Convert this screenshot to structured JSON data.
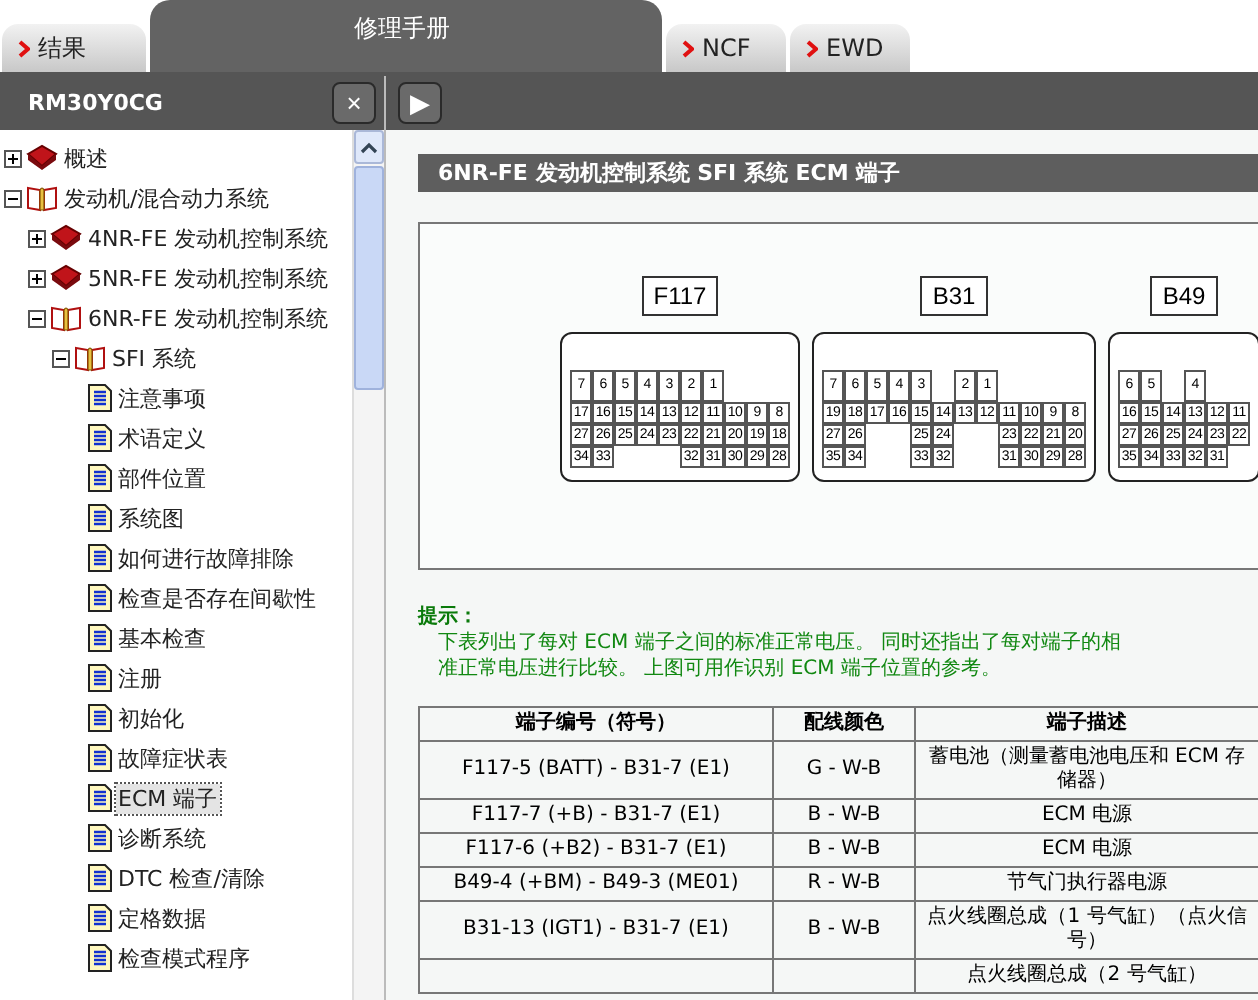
{
  "tabs": [
    {
      "label": "结果",
      "arrow": true,
      "selected": false
    },
    {
      "label": "修理手册",
      "arrow": false,
      "selected": true
    },
    {
      "label": "NCF",
      "arrow": true,
      "selected": false
    },
    {
      "label": "EWD",
      "arrow": true,
      "selected": false
    }
  ],
  "sidebar": {
    "title": "RM30Y0CG",
    "close": "×",
    "tree": [
      {
        "label": "概述",
        "kind": "book",
        "expanded": false
      },
      {
        "label": "发动机/混合动力系统",
        "kind": "open-book",
        "expanded": true,
        "children": [
          {
            "label": "4NR-FE 发动机控制系统",
            "kind": "book",
            "expanded": false
          },
          {
            "label": "5NR-FE 发动机控制系统",
            "kind": "book",
            "expanded": false
          },
          {
            "label": "6NR-FE 发动机控制系统",
            "kind": "open-book",
            "expanded": true,
            "children": [
              {
                "label": "SFI 系统",
                "kind": "open-book",
                "expanded": true,
                "children": [
                  {
                    "label": "注意事项",
                    "kind": "page",
                    "selected": false
                  },
                  {
                    "label": "术语定义",
                    "kind": "page",
                    "selected": false
                  },
                  {
                    "label": "部件位置",
                    "kind": "page",
                    "selected": false
                  },
                  {
                    "label": "系统图",
                    "kind": "page",
                    "selected": false
                  },
                  {
                    "label": "如何进行故障排除",
                    "kind": "page",
                    "selected": false
                  },
                  {
                    "label": "检查是否存在间歇性",
                    "kind": "page",
                    "selected": false
                  },
                  {
                    "label": "基本检查",
                    "kind": "page",
                    "selected": false
                  },
                  {
                    "label": "注册",
                    "kind": "page",
                    "selected": false
                  },
                  {
                    "label": "初始化",
                    "kind": "page",
                    "selected": false
                  },
                  {
                    "label": "故障症状表",
                    "kind": "page",
                    "selected": false
                  },
                  {
                    "label": "ECM 端子",
                    "kind": "page",
                    "selected": true
                  },
                  {
                    "label": "诊断系统",
                    "kind": "page",
                    "selected": false
                  },
                  {
                    "label": "DTC 检查/清除",
                    "kind": "page",
                    "selected": false
                  },
                  {
                    "label": "定格数据",
                    "kind": "page",
                    "selected": false
                  },
                  {
                    "label": "检查模式程序",
                    "kind": "page",
                    "selected": false
                  }
                ]
              }
            ]
          }
        ]
      }
    ]
  },
  "toolbar": {
    "play": "▶"
  },
  "content": {
    "title": "6NR-FE 发动机控制系统  SFI 系统  ECM 端子",
    "connectors": [
      {
        "name": "F117",
        "rows": [
          [
            "7",
            "6",
            "5",
            "4",
            "3",
            "2",
            "1"
          ],
          [
            "17",
            "16",
            "15",
            "14",
            "13",
            "12",
            "11",
            "10",
            "9",
            "8"
          ],
          [
            "27",
            "26",
            "25",
            "24",
            "23",
            "22",
            "21",
            "20",
            "19",
            "18"
          ],
          [
            "34",
            "33",
            "",
            "",
            "",
            "32",
            "31",
            "30",
            "29",
            "28"
          ]
        ]
      },
      {
        "name": "B31",
        "rows": [
          [
            "7",
            "6",
            "5",
            "4",
            "3",
            "",
            "2",
            "1"
          ],
          [
            "19",
            "18",
            "17",
            "16",
            "15",
            "14",
            "13",
            "12",
            "11",
            "10",
            "9",
            "8"
          ],
          [
            "27",
            "26",
            "",
            "",
            "25",
            "24",
            "",
            "",
            "23",
            "22",
            "21",
            "20"
          ],
          [
            "35",
            "34",
            "",
            "",
            "33",
            "32",
            "",
            "",
            "31",
            "30",
            "29",
            "28"
          ]
        ]
      },
      {
        "name": "B49",
        "rows": [
          [
            "6",
            "5",
            "",
            "4"
          ],
          [
            "16",
            "15",
            "14",
            "13",
            "12",
            "11"
          ],
          [
            "27",
            "26",
            "25",
            "24",
            "23",
            "22"
          ],
          [
            "35",
            "34",
            "33",
            "32",
            "31"
          ]
        ]
      }
    ],
    "hint": {
      "label": "提示：",
      "lines": [
        "下表列出了每对 ECM 端子之间的标准正常电压。 同时还指出了每对端子的相",
        "准正常电压进行比较。 上图可用作识别 ECM 端子位置的参考。"
      ]
    },
    "table": {
      "columns": [
        "端子编号（符号）",
        "配线颜色",
        "端子描述"
      ],
      "rows": [
        {
          "terminal": "F117-5 (BATT) - B31-7 (E1)",
          "wire": "G - W-B",
          "description": "蓄电池（测量蓄电池电压和 ECM 存储器）"
        },
        {
          "terminal": "F117-7 (+B) - B31-7 (E1)",
          "wire": "B - W-B",
          "description": "ECM 电源"
        },
        {
          "terminal": "F117-6 (+B2) - B31-7 (E1)",
          "wire": "B - W-B",
          "description": "ECM 电源"
        },
        {
          "terminal": "B49-4 (+BM) - B49-3 (ME01)",
          "wire": "R - W-B",
          "description": "节气门执行器电源"
        },
        {
          "terminal": "B31-13 (IGT1) - B31-7 (E1)",
          "wire": "B - W-B",
          "description": "点火线圈总成（1 号气缸）（点火信号）"
        },
        {
          "description": "点火线圈总成（2 号气缸）"
        }
      ]
    }
  }
}
